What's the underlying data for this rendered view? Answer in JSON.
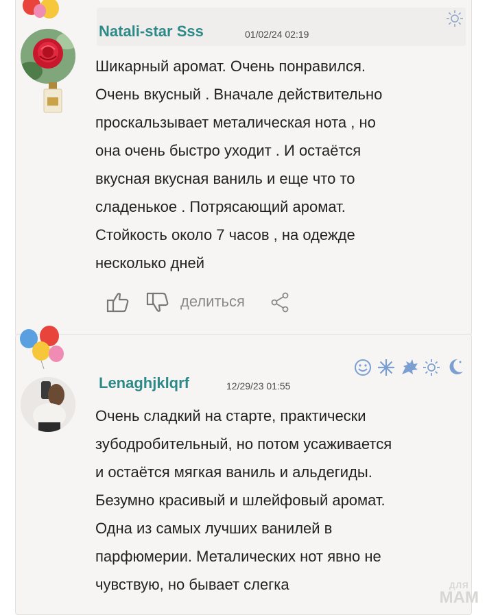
{
  "comments": [
    {
      "username": "Natali-star Sss",
      "date": "01/02/24 02:19",
      "lines": [
        "Шикарный аромат. Очень понравился.",
        "Очень вкусный . Вначале действительно",
        "проскальзывает металическая нота , но",
        "она очень быстро уходит . И остаётся",
        "вкусная вкусная ваниль и еще что то",
        "сладенькое . Потрясающий аромат.",
        "Стойкость около 7 часов , на одежде",
        "несколько дней"
      ],
      "share_label": "делиться",
      "status_icons": [
        "sun-icon"
      ]
    },
    {
      "username": "Lenaghjklqrf",
      "date": "12/29/23 01:55",
      "lines": [
        "Очень сладкий на старте, практически",
        "зубодробительный, но потом усаживается",
        "и остаётся мягкая ваниль и альдегиды.",
        "Безумно красивый и шлейфовый аромат.",
        "Одна из самых лучших ванилей в",
        "парфюмерии. Металических нот явно не",
        "чувствую, но бывает слегка"
      ],
      "status_icons": [
        "smiley-icon",
        "snowflake-icon",
        "leaf-icon",
        "sun-icon",
        "moon-icon"
      ]
    }
  ],
  "watermark": {
    "line1": "ДЛЯ",
    "line2": "МАМ"
  },
  "colors": {
    "username": "#2e8a88",
    "card_bg": "#f6f5f4",
    "icon": "#7a9fd0"
  }
}
